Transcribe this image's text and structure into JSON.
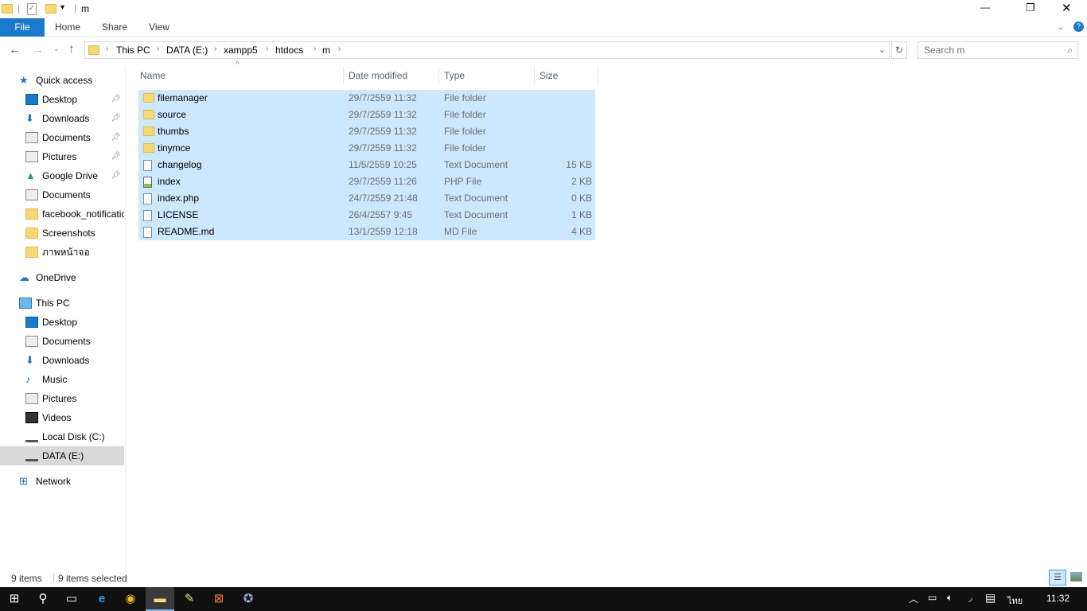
{
  "window": {
    "title": "m",
    "controls": {
      "minimize": "—",
      "maximize": "❐",
      "close": "✕"
    }
  },
  "ribbon": {
    "tabs": [
      "File",
      "Home",
      "Share",
      "View"
    ]
  },
  "address": {
    "crumbs": [
      "This PC",
      "DATA (E:)",
      "xampp5",
      "htdocs",
      "m"
    ]
  },
  "search": {
    "placeholder": "Search m"
  },
  "sidebar": [
    {
      "label": "Quick access",
      "icon": "star-icon",
      "level": 0,
      "pinned": false
    },
    {
      "label": "Desktop",
      "icon": "desktop-icon",
      "level": 1,
      "pinned": true
    },
    {
      "label": "Downloads",
      "icon": "download-icon",
      "level": 1,
      "pinned": true
    },
    {
      "label": "Documents",
      "icon": "documents-icon",
      "level": 1,
      "pinned": true
    },
    {
      "label": "Pictures",
      "icon": "pictures-icon",
      "level": 1,
      "pinned": true
    },
    {
      "label": "Google Drive",
      "icon": "google-drive-icon",
      "level": 1,
      "pinned": true
    },
    {
      "label": "Documents",
      "icon": "documents-icon",
      "level": 1,
      "pinned": false
    },
    {
      "label": "facebook_notifications",
      "icon": "folder-icon",
      "level": 1,
      "pinned": false
    },
    {
      "label": "Screenshots",
      "icon": "folder-icon",
      "level": 1,
      "pinned": false
    },
    {
      "label": "ภาพหน้าจอ",
      "icon": "folder-icon",
      "level": 1,
      "pinned": false
    },
    {
      "label": "OneDrive",
      "icon": "onedrive-icon",
      "level": 0,
      "pinned": false,
      "gap": true
    },
    {
      "label": "This PC",
      "icon": "computer-icon",
      "level": 0,
      "pinned": false,
      "gap": true
    },
    {
      "label": "Desktop",
      "icon": "desktop-icon",
      "level": 1,
      "pinned": false
    },
    {
      "label": "Documents",
      "icon": "documents-icon",
      "level": 1,
      "pinned": false
    },
    {
      "label": "Downloads",
      "icon": "download-icon",
      "level": 1,
      "pinned": false
    },
    {
      "label": "Music",
      "icon": "music-icon",
      "level": 1,
      "pinned": false
    },
    {
      "label": "Pictures",
      "icon": "pictures-icon",
      "level": 1,
      "pinned": false
    },
    {
      "label": "Videos",
      "icon": "videos-icon",
      "level": 1,
      "pinned": false
    },
    {
      "label": "Local Disk (C:)",
      "icon": "drive-icon",
      "level": 1,
      "pinned": false
    },
    {
      "label": "DATA (E:)",
      "icon": "drive-icon",
      "level": 1,
      "pinned": false,
      "selected": true
    },
    {
      "label": "Network",
      "icon": "network-icon",
      "level": 0,
      "pinned": false,
      "gap": true
    }
  ],
  "columns": [
    "Name",
    "Date modified",
    "Type",
    "Size"
  ],
  "files": [
    {
      "name": "filemanager",
      "date": "29/7/2559 11:32",
      "type": "File folder",
      "size": "",
      "kind": "folder"
    },
    {
      "name": "source",
      "date": "29/7/2559 11:32",
      "type": "File folder",
      "size": "",
      "kind": "folder"
    },
    {
      "name": "thumbs",
      "date": "29/7/2559 11:32",
      "type": "File folder",
      "size": "",
      "kind": "folder"
    },
    {
      "name": "tinymce",
      "date": "29/7/2559 11:32",
      "type": "File folder",
      "size": "",
      "kind": "folder"
    },
    {
      "name": "changelog",
      "date": "11/5/2559 10:25",
      "type": "Text Document",
      "size": "15 KB",
      "kind": "text"
    },
    {
      "name": "index",
      "date": "29/7/2559 11:26",
      "type": "PHP File",
      "size": "2 KB",
      "kind": "php"
    },
    {
      "name": "index.php",
      "date": "24/7/2559 21:48",
      "type": "Text Document",
      "size": "0 KB",
      "kind": "text"
    },
    {
      "name": "LICENSE",
      "date": "26/4/2557 9:45",
      "type": "Text Document",
      "size": "1 KB",
      "kind": "text"
    },
    {
      "name": "README.md",
      "date": "13/1/2559 12:18",
      "type": "MD File",
      "size": "4 KB",
      "kind": "file"
    }
  ],
  "status": {
    "items": "9 items",
    "selected": "9 items selected"
  },
  "taskbar": {
    "language": "ไทย",
    "time": "11:32"
  },
  "colors": {
    "accent": "#1979ca",
    "selection": "#cce8ff",
    "taskbar": "#101010"
  }
}
